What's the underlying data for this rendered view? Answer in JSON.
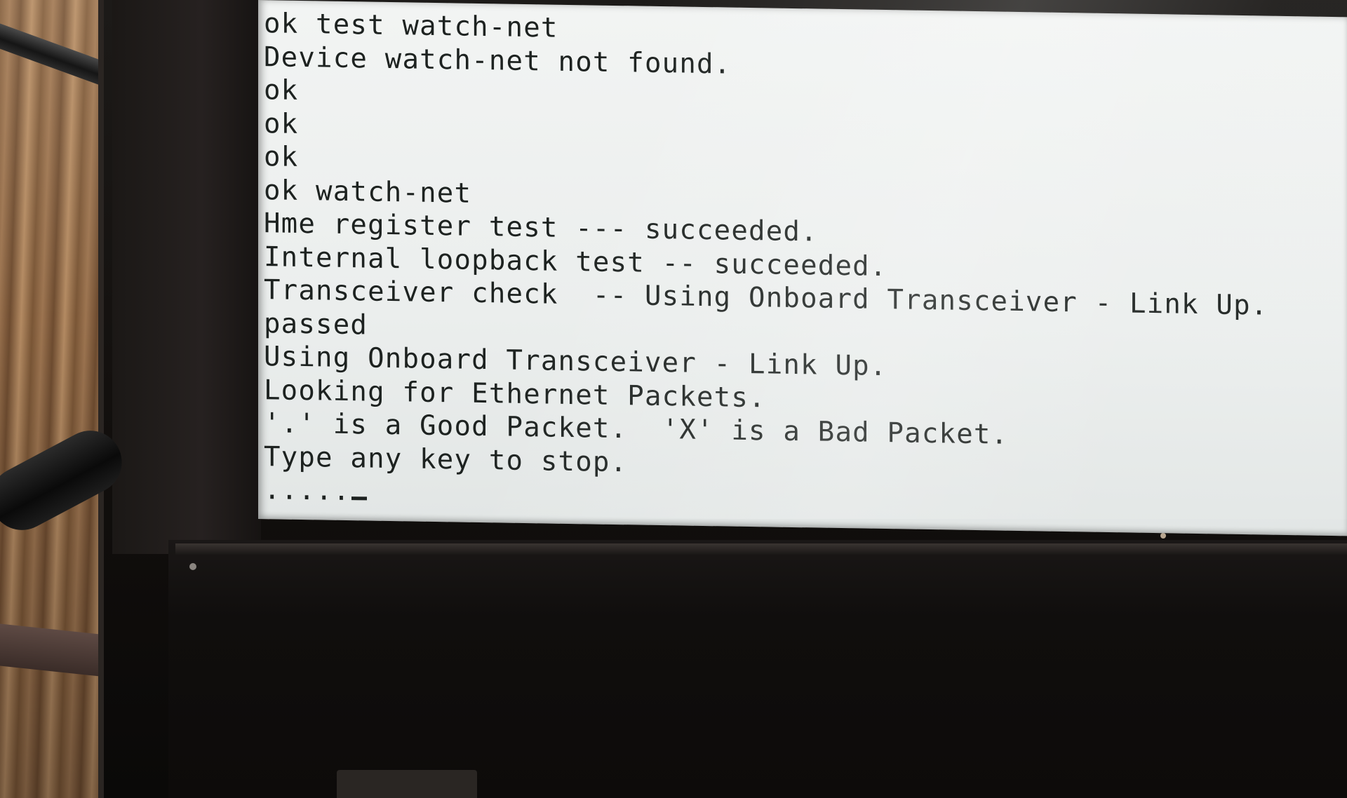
{
  "terminal": {
    "lines": [
      "ok test watch-net",
      "Device watch-net not found.",
      "ok",
      "ok",
      "ok",
      "ok watch-net",
      "Hme register test --- succeeded.",
      "Internal loopback test -- succeeded.",
      "Transceiver check  -- Using Onboard Transceiver - Link Up.",
      "passed",
      "Using Onboard Transceiver - Link Up.",
      "Looking for Ethernet Packets.",
      "'.' is a Good Packet.  'X' is a Bad Packet.",
      "Type any key to stop.",
      "....."
    ]
  }
}
